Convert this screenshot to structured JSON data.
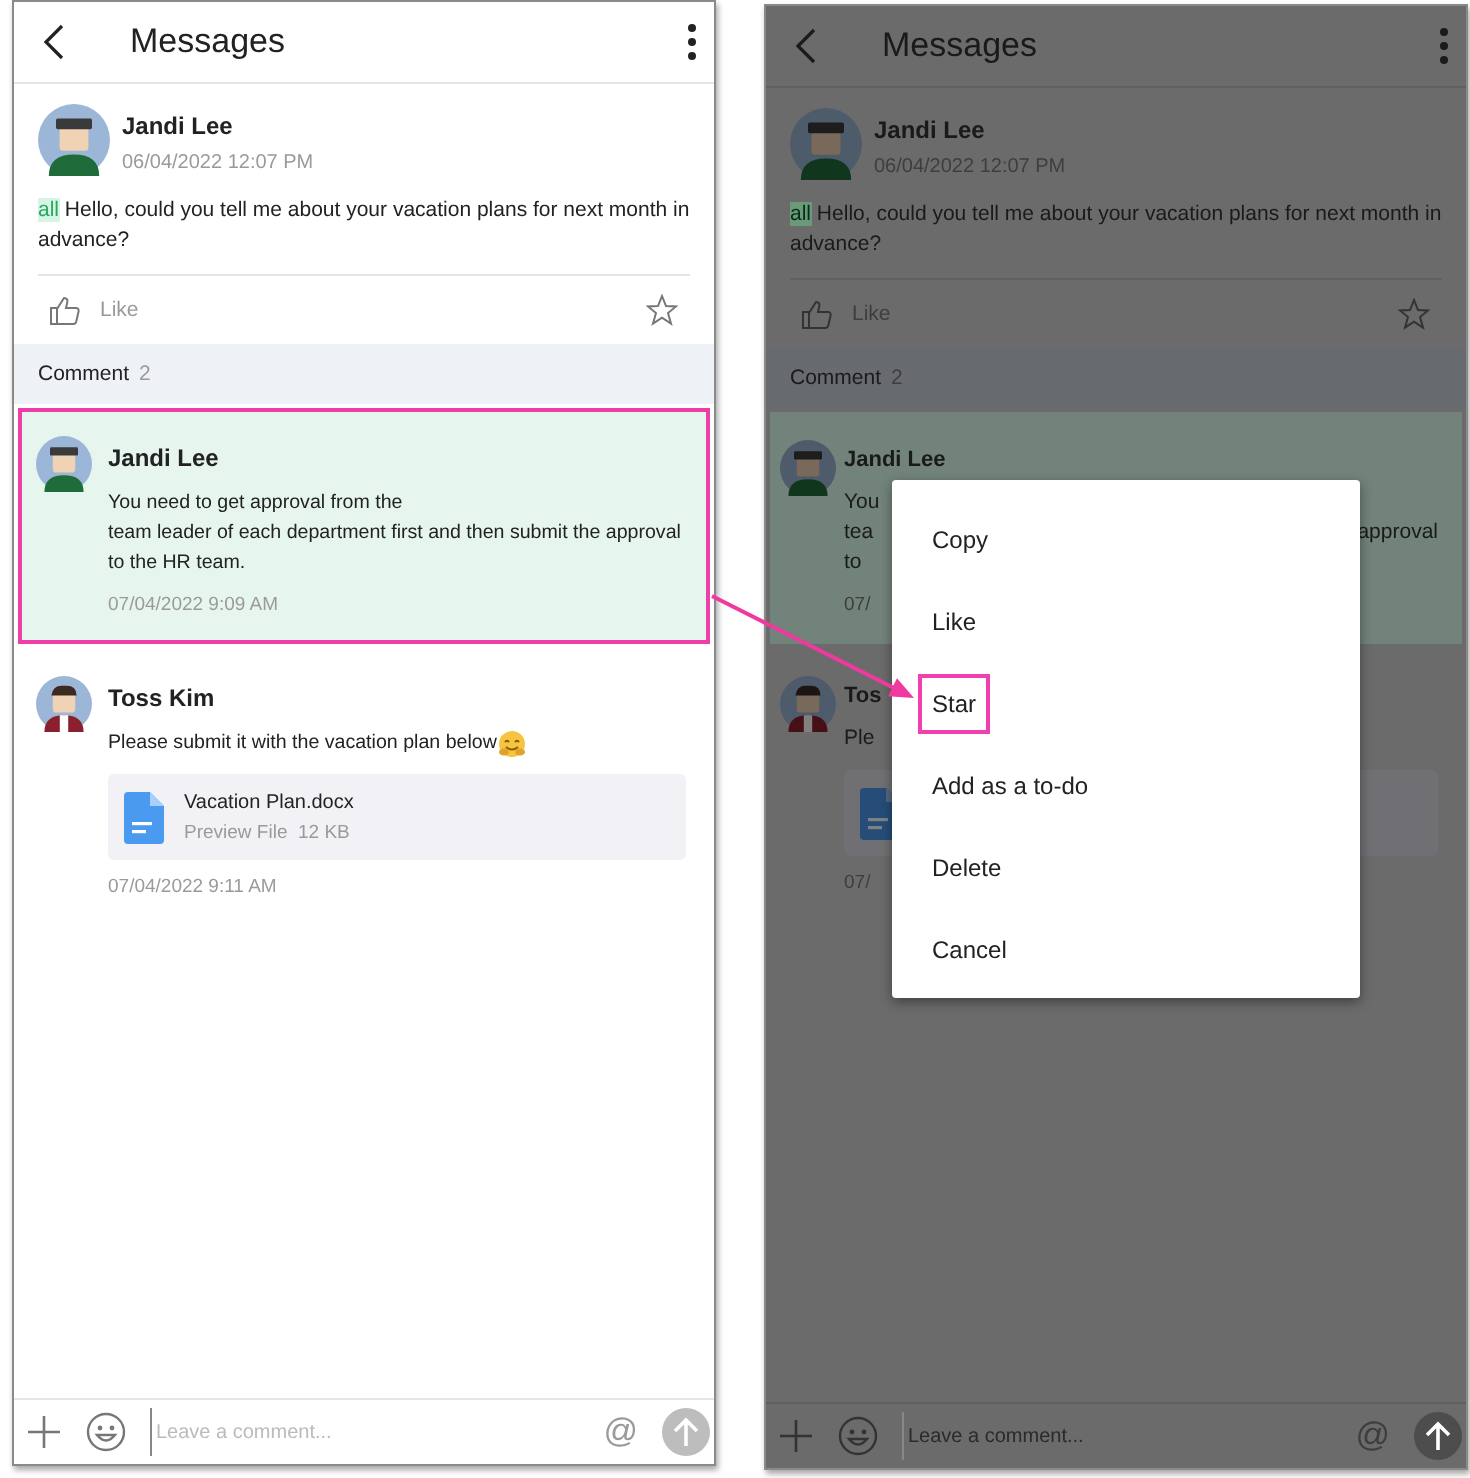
{
  "screens": [
    {
      "kind": "normal",
      "title": "Messages",
      "post": {
        "author": "Jandi Lee",
        "time": "06/04/2022 12:07 PM",
        "mention": "all",
        "text": "Hello, could you tell me about your vacation plans for next month in advance?",
        "like_label": "Like"
      },
      "comment_label": "Comment",
      "comment_count": "2",
      "comments": [
        {
          "author": "Jandi Lee",
          "text": "You need to get approval from the\nteam leader of each department first and then submit the approval to the HR team.",
          "time": "07/04/2022 9:09 AM",
          "selected": true
        },
        {
          "author": "Toss Kim",
          "text": "Please submit it with the vacation plan below",
          "emoji": true,
          "attachment": {
            "kind": "file",
            "name": "Vacation Plan.docx",
            "meta": "Preview File  12 KB"
          },
          "time": "07/04/2022 9:11 AM",
          "selected": false
        }
      ],
      "composer": {
        "placeholder": "Leave a comment...",
        "mention_symbol": "@"
      }
    },
    {
      "kind": "dimmed",
      "title": "Messages",
      "post": {
        "author": "Jandi Lee",
        "time": "06/04/2022 12:07 PM",
        "mention": "all",
        "text": "Hello, could you tell me about your vacation plans for next month in advance?",
        "like_label": "Like"
      },
      "comment_label": "Comment",
      "comment_count": "2",
      "comments": [
        {
          "author": "Jandi Lee",
          "fragments": [
            {
              "left": "You"
            },
            {
              "left": "tea",
              "right": "approval"
            },
            {
              "left": "to"
            }
          ],
          "time": "07/",
          "selected": true
        },
        {
          "author": "Tos",
          "fragments": [
            {
              "left": "Ple"
            }
          ],
          "attachment": {
            "kind": "file"
          },
          "time": "07/",
          "selected": false
        }
      ],
      "composer": {
        "placeholder": "Leave a comment...",
        "mention_symbol": "@"
      },
      "menu": {
        "items": [
          {
            "label": "Copy",
            "selected": false
          },
          {
            "label": "Like",
            "selected": false
          },
          {
            "label": "Star",
            "selected": true
          },
          {
            "label": "Add as a to-do",
            "selected": false
          },
          {
            "label": "Delete",
            "selected": false
          },
          {
            "label": "Cancel",
            "selected": false
          }
        ]
      }
    }
  ]
}
